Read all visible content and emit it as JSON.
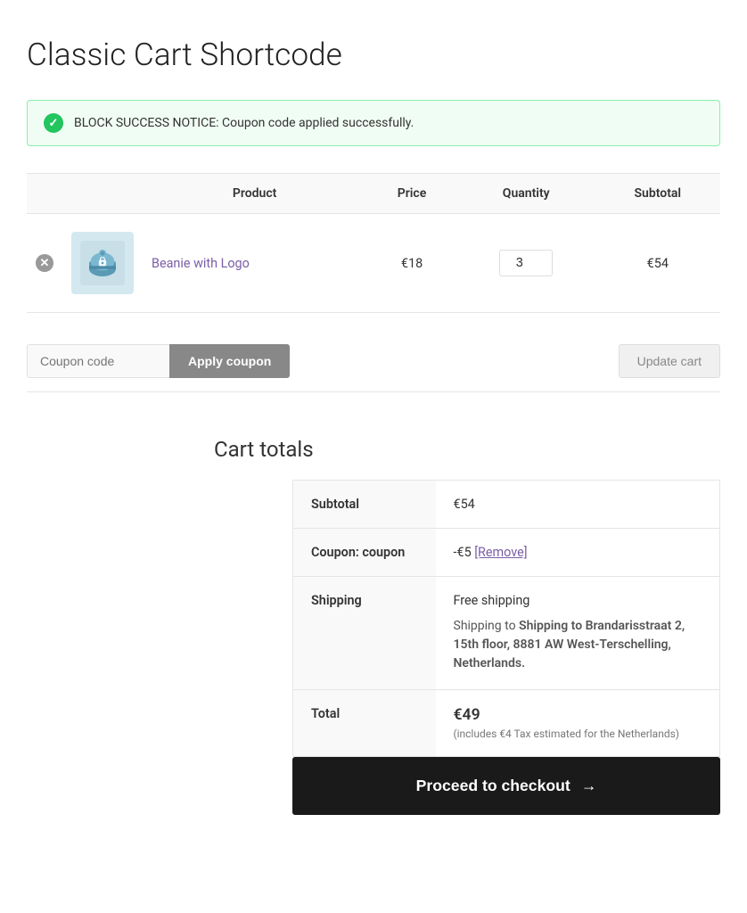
{
  "page": {
    "title": "Classic Cart Shortcode"
  },
  "notice": {
    "text": "BLOCK SUCCESS NOTICE: Coupon code applied successfully."
  },
  "table": {
    "headers": {
      "product": "Product",
      "price": "Price",
      "quantity": "Quantity",
      "subtotal": "Subtotal"
    },
    "rows": [
      {
        "product_name": "Beanie with Logo",
        "price": "€18",
        "quantity": 3,
        "subtotal": "€54"
      }
    ]
  },
  "coupon": {
    "placeholder": "Coupon code",
    "apply_label": "Apply coupon",
    "update_label": "Update cart"
  },
  "cart_totals": {
    "title": "Cart totals",
    "subtotal_label": "Subtotal",
    "subtotal_value": "€54",
    "coupon_label": "Coupon: coupon",
    "coupon_discount": "-€5",
    "remove_label": "[Remove]",
    "shipping_label": "Shipping",
    "shipping_value": "Free shipping",
    "shipping_address": "Shipping to Brandarisstraat 2, 15th floor, 8881 AW West-Terschelling, Netherlands.",
    "total_label": "Total",
    "total_value": "€49",
    "tax_note": "(includes €4 Tax estimated for the Netherlands)"
  },
  "checkout": {
    "button_label": "Proceed to checkout",
    "arrow": "→"
  }
}
